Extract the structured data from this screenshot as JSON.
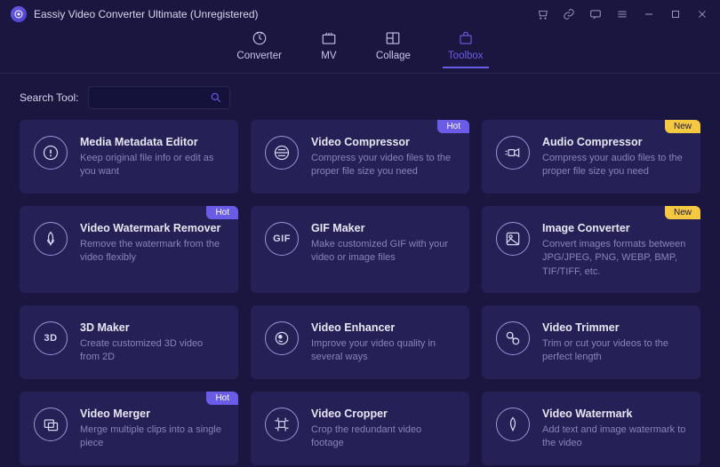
{
  "app": {
    "title": "Eassiy Video Converter Ultimate (Unregistered)"
  },
  "nav": {
    "converter": "Converter",
    "mv": "MV",
    "collage": "Collage",
    "toolbox": "Toolbox"
  },
  "search": {
    "label": "Search Tool:",
    "placeholder": ""
  },
  "badges": {
    "hot": "Hot",
    "new": "New"
  },
  "tools": [
    {
      "title": "Media Metadata Editor",
      "desc": "Keep original file info or edit as you want",
      "badge": ""
    },
    {
      "title": "Video Compressor",
      "desc": "Compress your video files to the proper file size you need",
      "badge": "hot"
    },
    {
      "title": "Audio Compressor",
      "desc": "Compress your audio files to the proper file size you need",
      "badge": "new"
    },
    {
      "title": "Video Watermark Remover",
      "desc": "Remove the watermark from the video flexibly",
      "badge": "hot"
    },
    {
      "title": "GIF Maker",
      "desc": "Make customized GIF with your video or image files",
      "badge": ""
    },
    {
      "title": "Image Converter",
      "desc": "Convert images formats between JPG/JPEG, PNG, WEBP, BMP, TIF/TIFF, etc.",
      "badge": "new"
    },
    {
      "title": "3D Maker",
      "desc": "Create customized 3D video from 2D",
      "badge": ""
    },
    {
      "title": "Video Enhancer",
      "desc": "Improve your video quality in several ways",
      "badge": ""
    },
    {
      "title": "Video Trimmer",
      "desc": "Trim or cut your videos to the perfect length",
      "badge": ""
    },
    {
      "title": "Video Merger",
      "desc": "Merge multiple clips into a single piece",
      "badge": "hot"
    },
    {
      "title": "Video Cropper",
      "desc": "Crop the redundant video footage",
      "badge": ""
    },
    {
      "title": "Video Watermark",
      "desc": "Add text and image watermark to the video",
      "badge": ""
    }
  ]
}
